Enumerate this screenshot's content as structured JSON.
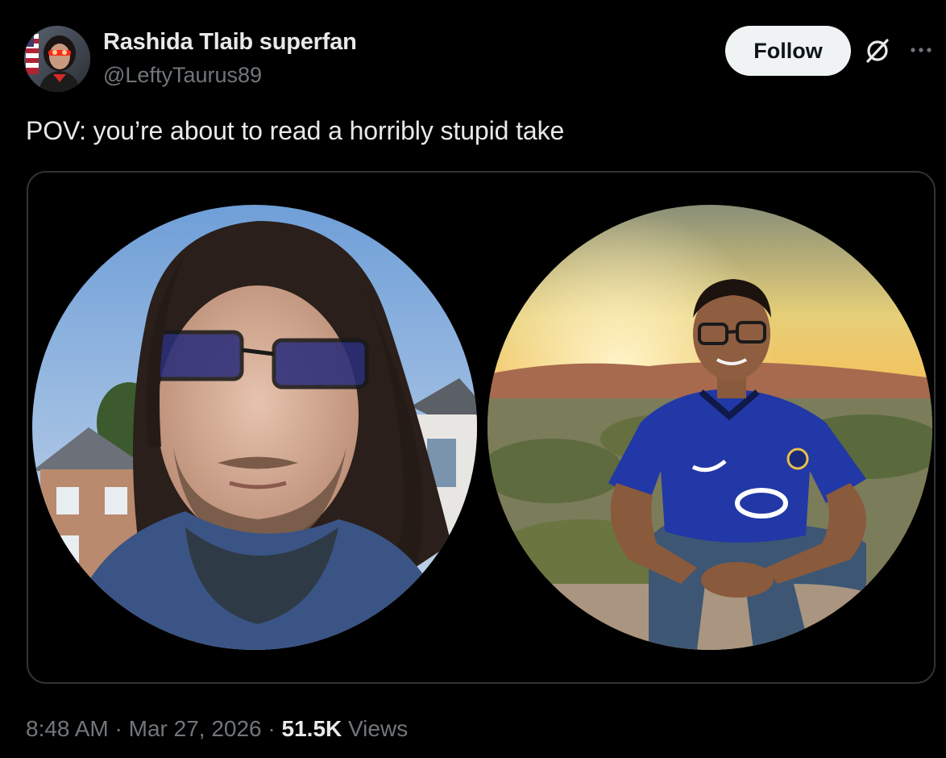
{
  "author": {
    "display_name": "Rashida Tlaib superfan",
    "handle": "@LeftyTaurus89",
    "avatar_icon": "avatar-photo-woman-laser-eyes"
  },
  "actions": {
    "follow_label": "Follow",
    "grok_icon": "grok-slash-circle-icon",
    "more_icon": "more-dots-icon"
  },
  "tweet": {
    "text": "POV: you’re about to read a horribly stupid take"
  },
  "media": {
    "description_left": "selfie-man-long-hair-sunglasses",
    "description_right": "man-sitting-sunset-blue-jersey"
  },
  "meta": {
    "time": "8:48 AM",
    "sep1": " · ",
    "date": "Mar 27, 2026",
    "sep2": " · ",
    "views_count": "51.5K",
    "views_label": " Views"
  },
  "colors": {
    "background": "#000000",
    "text_primary": "#e7e9ea",
    "text_secondary": "#71767b",
    "border": "#2f3336",
    "follow_bg": "#eff3f4"
  }
}
